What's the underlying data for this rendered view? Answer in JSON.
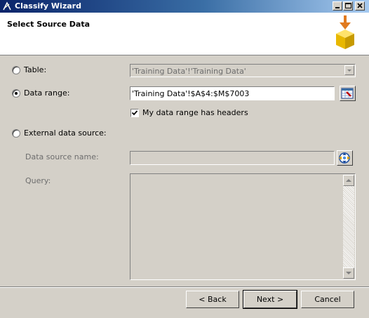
{
  "window": {
    "title": "Classify Wizard"
  },
  "header": {
    "title": "Select Source Data"
  },
  "table_option": {
    "label": "Table:",
    "value": "'Training Data'!'Training Data'",
    "selected": false
  },
  "range_option": {
    "label": "Data range:",
    "value": "'Training Data'!$A$4:$M$7003",
    "selected": true,
    "headers_label": "My data range has headers",
    "headers_checked": true
  },
  "external_option": {
    "label": "External data source:",
    "selected": false,
    "source_name_label": "Data source name:",
    "source_name_value": "",
    "query_label": "Query:",
    "query_value": ""
  },
  "buttons": {
    "back": "< Back",
    "next": "Next >",
    "cancel": "Cancel"
  },
  "icons": {
    "title": "classify-icon",
    "header": "database-import-icon",
    "range_picker": "range-picker-icon",
    "source_picker": "data-source-icon"
  }
}
